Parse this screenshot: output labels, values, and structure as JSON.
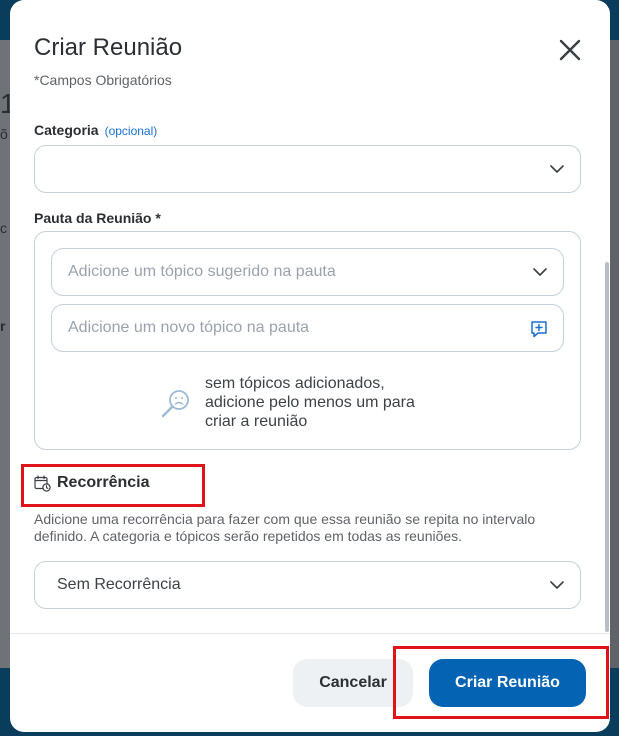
{
  "background": {
    "fragments": [
      "1",
      "õ",
      "c",
      "r"
    ]
  },
  "modal": {
    "title": "Criar Reunião",
    "required_note": "*Campos Obrigatórios",
    "category": {
      "label": "Categoria",
      "optional": "(opcional)",
      "value": ""
    },
    "agenda": {
      "label": "Pauta da Reunião *",
      "suggested_placeholder": "Adicione um tópico sugerido na pauta",
      "new_placeholder": "Adicione um novo tópico na pauta",
      "empty_message": "sem tópicos adicionados, adicione pelo menos um para criar a reunião"
    },
    "recurrence": {
      "label": "Recorrência",
      "description": "Adicione uma recorrência para fazer com que essa reunião se repita no intervalo definido. A categoria e tópicos serão repetidos em todas as reuniões.",
      "value": "Sem Recorrência"
    },
    "buttons": {
      "cancel": "Cancelar",
      "create": "Criar Reunião"
    }
  },
  "colors": {
    "primary": "#0563b4",
    "highlight": "#e0131b",
    "link": "#1a6fd1"
  }
}
